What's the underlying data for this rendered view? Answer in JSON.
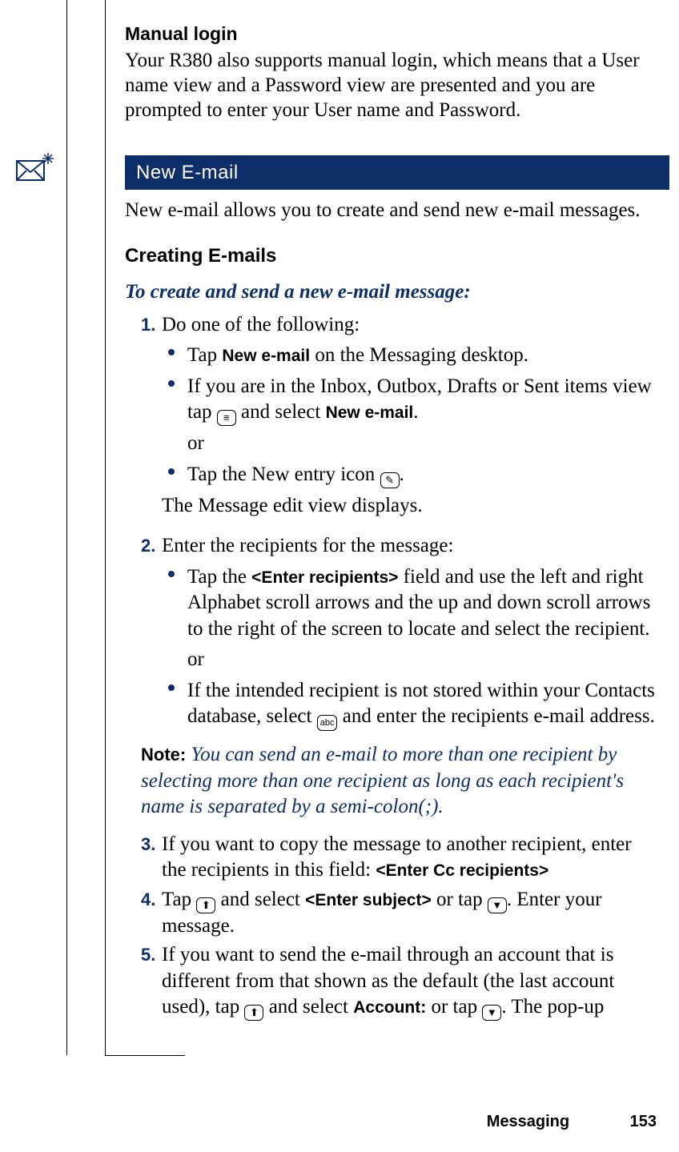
{
  "manual_login": {
    "heading": "Manual login",
    "body": "Your R380 also supports manual login, which means that a User name view and a Password view are presented and you are prompted to enter your User name and Password."
  },
  "section_bar": "New E-mail",
  "section_intro": "New e-mail allows you to create and send new e-mail messages.",
  "subsection_heading": "Creating E-mails",
  "task_heading": "To create and send a new e-mail message:",
  "step1": {
    "num": "1.",
    "text": "Do one of the following:",
    "bullet1_pre": "Tap ",
    "bullet1_bold": "New e-mail",
    "bullet1_post": " on the Messaging desktop.",
    "bullet2_pre": "If you are in the Inbox, Outbox, Drafts or Sent items view tap ",
    "bullet2_mid": " and select ",
    "bullet2_bold": "New e-mail",
    "bullet2_end": ".",
    "or": "or",
    "bullet3_pre": "Tap the New entry icon ",
    "bullet3_end": ".",
    "trail": "The Message edit view displays."
  },
  "step2": {
    "num": "2.",
    "text": "Enter the recipients for the message:",
    "bullet1_pre": "Tap the ",
    "bullet1_bold": "<Enter recipients>",
    "bullet1_post": " field and use the left and right Alphabet scroll arrows and the up and down scroll arrows to the right of the screen to locate and select the recipient.",
    "or": "or",
    "bullet2_pre": "If the intended recipient is not stored within your Contacts database, select ",
    "bullet2_post": " and enter the recipients e-mail address."
  },
  "note": {
    "label": "Note:",
    "body": "You can send an e-mail to more than one recipient by selecting more than one recipient as long as each recipient's name is separated by a semi-colon(;)."
  },
  "step3": {
    "num": "3.",
    "pre": "If you want to copy the message to another recipient, enter the recipients in this field: ",
    "bold": "<Enter Cc recipients>"
  },
  "step4": {
    "num": "4.",
    "pre": "Tap ",
    "mid1": " and select ",
    "bold": "<Enter subject>",
    "mid2": " or tap ",
    "end": ". Enter your message."
  },
  "step5": {
    "num": "5.",
    "pre": "If you want to send the e-mail through an account that is different from that shown as the default (the last account used), tap ",
    "mid1": " and select ",
    "bold": "Account:",
    "mid2": " or tap ",
    "end": ". The pop-up"
  },
  "icons": {
    "menu": "≡",
    "newentry": "✎",
    "abc": "abc",
    "up_arrow": "⬆",
    "down_arrow": "▼"
  },
  "footer": {
    "section": "Messaging",
    "page": "153"
  }
}
